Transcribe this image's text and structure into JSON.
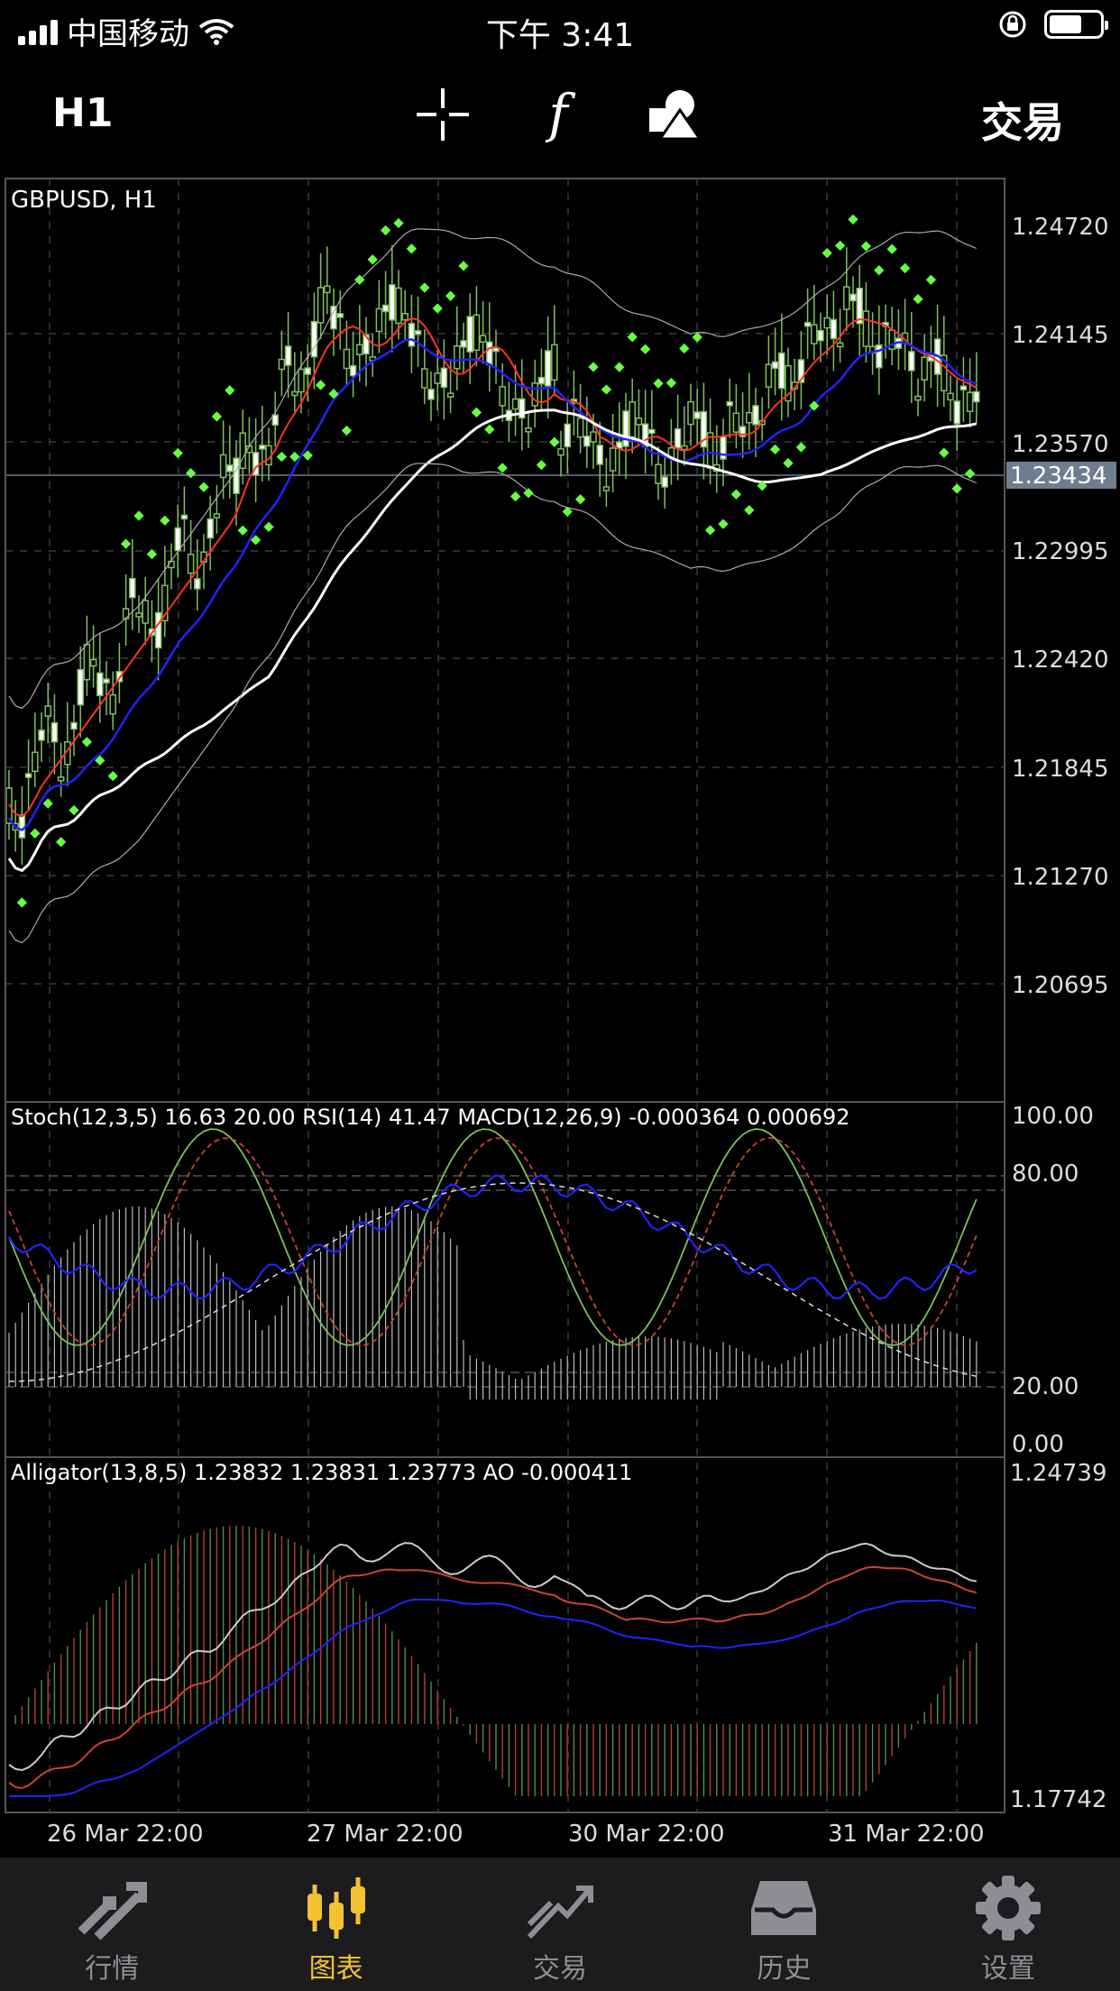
{
  "status": {
    "carrier": "中国移动",
    "time": "下午 3:41",
    "battery_level": 0.65
  },
  "toolbar": {
    "timeframe": "H1",
    "trade_label": "交易",
    "icons": [
      "crosshair-icon",
      "indicators-f-icon",
      "objects-shapes-icon"
    ]
  },
  "chart": {
    "symbol_label": "GBPUSD, H1",
    "price_axis": [
      "1.24720",
      "1.24145",
      "1.23570",
      "1.22995",
      "1.22420",
      "1.21845",
      "1.21270",
      "1.20695"
    ],
    "current_price": "1.23434",
    "time_axis": [
      "26 Mar 22:00",
      "27 Mar 22:00",
      "30 Mar 22:00",
      "31 Mar 22:00"
    ],
    "osc_label": "Stoch(12,3,5) 16.63 20.00 RSI(14) 41.47 MACD(12,26,9) -0.000364 0.000692",
    "osc_levels": [
      "100.00",
      "80.00",
      "20.00",
      "0.00"
    ],
    "alligator_label": "Alligator(13,8,5) 1.23832 1.23831 1.23773 AO -0.000411",
    "alligator_levels": [
      "1.24739",
      "1.17742"
    ],
    "colors": {
      "bull_candle": "#7fbf5f",
      "psar": "#66ff44",
      "ma_red": "#ff3322",
      "ma_blue": "#2222ff",
      "ma_white": "#ffffff",
      "current_price_bg": "#6e7e8e"
    }
  },
  "tabs": [
    {
      "label": "行情",
      "icon": "quotes-arrows-icon",
      "active": false
    },
    {
      "label": "图表",
      "icon": "chart-candles-icon",
      "active": true
    },
    {
      "label": "交易",
      "icon": "trade-trend-icon",
      "active": false
    },
    {
      "label": "历史",
      "icon": "history-tray-icon",
      "active": false
    },
    {
      "label": "设置",
      "icon": "settings-gear-icon",
      "active": false
    }
  ]
}
